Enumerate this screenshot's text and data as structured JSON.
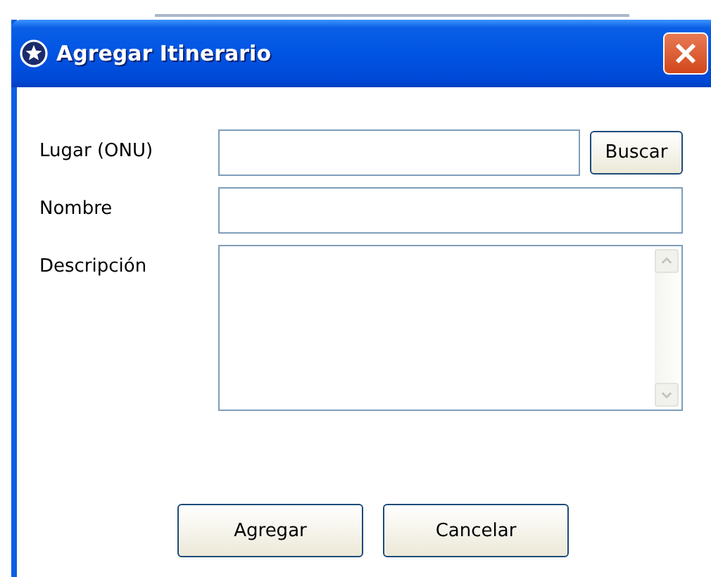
{
  "window": {
    "title": "Agregar Itinerario"
  },
  "fields": [
    {
      "label": "Lugar (ONU)",
      "kind": "text",
      "button": "Buscar"
    },
    {
      "label": "Nombre",
      "kind": "text"
    },
    {
      "label": "Descripción",
      "kind": "textarea"
    }
  ],
  "buttons": [
    "Agregar",
    "Cancelar"
  ]
}
